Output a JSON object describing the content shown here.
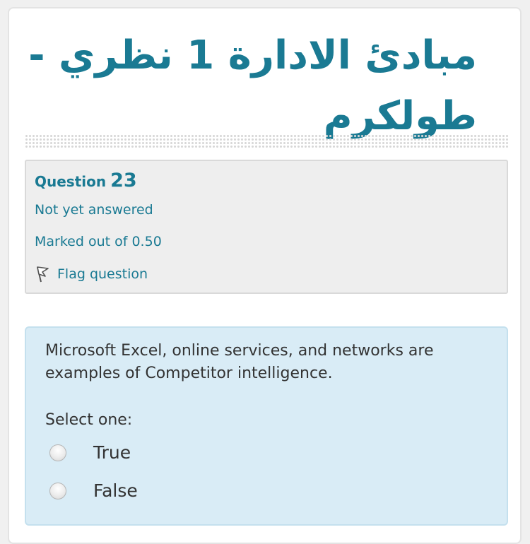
{
  "course": {
    "title": "مبادئ الادارة 1 نظري - طولكرم"
  },
  "question": {
    "label": "Question",
    "number": "23",
    "state": "Not yet answered",
    "grade": "Marked out of 0.50",
    "flag_label": "Flag question",
    "text": "Microsoft Excel, online services, and networks are examples of Competitor intelligence.",
    "prompt": "Select one:",
    "options": [
      {
        "label": "True"
      },
      {
        "label": "False"
      }
    ]
  },
  "colors": {
    "accent": "#1a7a93",
    "info_background": "#eeeeee",
    "question_background": "#d9ecf6"
  }
}
